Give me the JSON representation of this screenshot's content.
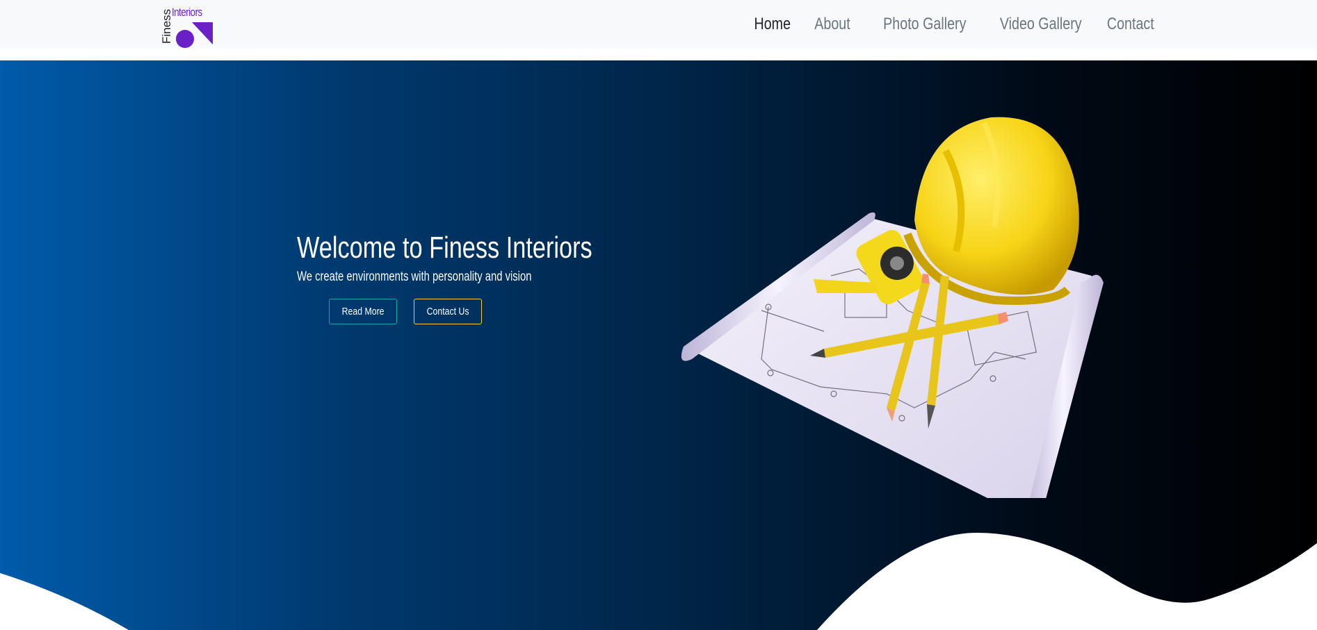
{
  "brand": {
    "logo_word_left": "Finess",
    "logo_word_right": "Interiors",
    "accent_color": "#6a1fc7"
  },
  "nav": {
    "items": [
      {
        "label": "Home",
        "active": true
      },
      {
        "label": "About",
        "active": false
      },
      {
        "label": "Photo Gallery",
        "active": false
      },
      {
        "label": "Video Gallery",
        "active": false
      },
      {
        "label": "Contact",
        "active": false
      }
    ]
  },
  "hero": {
    "title": "Welcome to Finess Interiors",
    "subtitle": "We create environments with personality and vision",
    "buttons": {
      "read_more": "Read More",
      "contact_us": "Contact Us"
    },
    "gradient_colors": [
      "#005baa",
      "#003a70",
      "#00264a",
      "#000b18",
      "#000000"
    ],
    "illustration": "construction-plans-with-hard-hat-tape-measure-pencils-illustration"
  }
}
